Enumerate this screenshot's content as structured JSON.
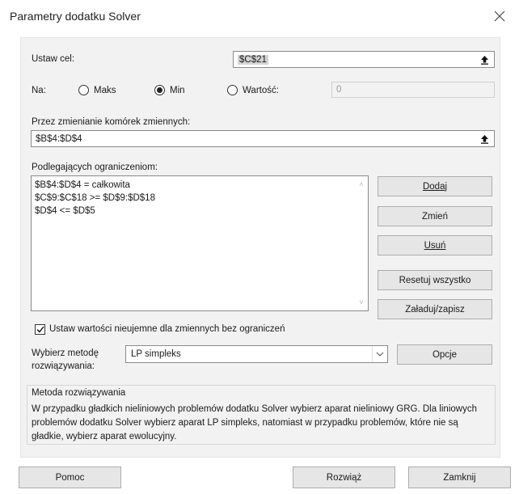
{
  "window": {
    "title": "Parametry dodatku Solver"
  },
  "objective": {
    "label": "Ustaw cel:",
    "value": "$C$21"
  },
  "to": {
    "label": "Na:",
    "options": [
      {
        "label": "Maks",
        "selected": false
      },
      {
        "label": "Min",
        "selected": true
      },
      {
        "label": "Wartość:",
        "selected": false
      }
    ],
    "value_field": "0"
  },
  "variables": {
    "label": "Przez zmienianie komórek zmiennych:",
    "value": "$B$4:$D$4"
  },
  "constraints": {
    "label": "Podlegających ograniczeniom:",
    "items": [
      "$B$4:$D$4 = całkowita",
      "$C$9:$C$18 >= $D$9:$D$18",
      "$D$4 <= $D$5"
    ]
  },
  "constraint_buttons": {
    "add": "Dodaj",
    "change": "Zmień",
    "delete": "Usuń",
    "reset": "Resetuj wszystko",
    "load_save": "Załaduj/zapisz"
  },
  "nonneg": {
    "label": "Ustaw wartości nieujemne dla zmiennych bez ograniczeń",
    "checked": true
  },
  "method": {
    "label_line1": "Wybierz metodę",
    "label_line2": "rozwiązywania:",
    "selected": "LP simpleks",
    "options_button": "Opcje"
  },
  "method_info": {
    "title": "Metoda rozwiązywania",
    "line1": "W przypadku gładkich nieliniowych problemów dodatku Solver wybierz aparat nieliniowy GRG. Dla liniowych",
    "line2": "problemów dodatku Solver wybierz aparat LP simpleks, natomiast w przypadku problemów, które nie są",
    "line3": "gładkie, wybierz aparat ewolucyjny."
  },
  "footer": {
    "help": "Pomoc",
    "solve": "Rozwiąż",
    "close": "Zamknij"
  },
  "icons": {
    "close": "close-icon",
    "collapse": "collapse-arrow-icon",
    "dropdown": "chevron-down-icon",
    "check": "check-icon"
  }
}
